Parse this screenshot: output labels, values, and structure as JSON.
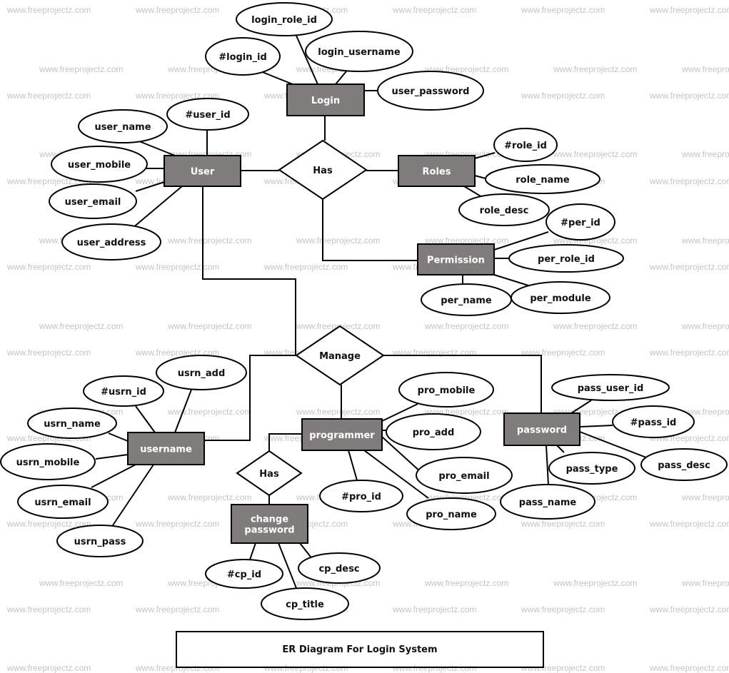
{
  "title": "ER Diagram For Login System",
  "watermark": "www.freeprojectz.com",
  "colors": {
    "entity_fill": "#7f7c7b",
    "entity_text": "#ffffff",
    "stroke": "#000000",
    "watermark": "#c4c4c4"
  },
  "entities": [
    {
      "id": "login",
      "label": "Login"
    },
    {
      "id": "user",
      "label": "User"
    },
    {
      "id": "roles",
      "label": "Roles"
    },
    {
      "id": "permission",
      "label": "Permission"
    },
    {
      "id": "username",
      "label": "username"
    },
    {
      "id": "programmer",
      "label": "programmer"
    },
    {
      "id": "password",
      "label": "password"
    },
    {
      "id": "change_password",
      "label": "change password",
      "lines": [
        "change",
        "password"
      ]
    }
  ],
  "relationships": [
    {
      "id": "has_main",
      "label": "Has",
      "connects": [
        "user",
        "login",
        "roles",
        "permission"
      ]
    },
    {
      "id": "manage",
      "label": "Manage",
      "connects": [
        "user",
        "username",
        "programmer",
        "password"
      ]
    },
    {
      "id": "has_cp",
      "label": "Has",
      "connects": [
        "programmer",
        "change_password"
      ]
    }
  ],
  "attributes": {
    "login": [
      "login_role_id",
      "#login_id",
      "login_username",
      "user_password"
    ],
    "user": [
      "#user_id",
      "user_name",
      "user_mobile",
      "user_email",
      "user_address"
    ],
    "roles": [
      "#role_id",
      "role_name",
      "role_desc"
    ],
    "permission": [
      "#per_id",
      "per_role_id",
      "per_name",
      "per_module"
    ],
    "username": [
      "usrn_add",
      "#usrn_id",
      "usrn_name",
      "usrn_mobile",
      "usrn_email",
      "usrn_pass"
    ],
    "programmer": [
      "pro_mobile",
      "pro_add",
      "pro_email",
      "#pro_id",
      "pro_name"
    ],
    "password": [
      "pass_user_id",
      "#pass_id",
      "pass_type",
      "pass_desc",
      "pass_name"
    ],
    "change_password": [
      "#cp_id",
      "cp_desc",
      "cp_title"
    ]
  }
}
